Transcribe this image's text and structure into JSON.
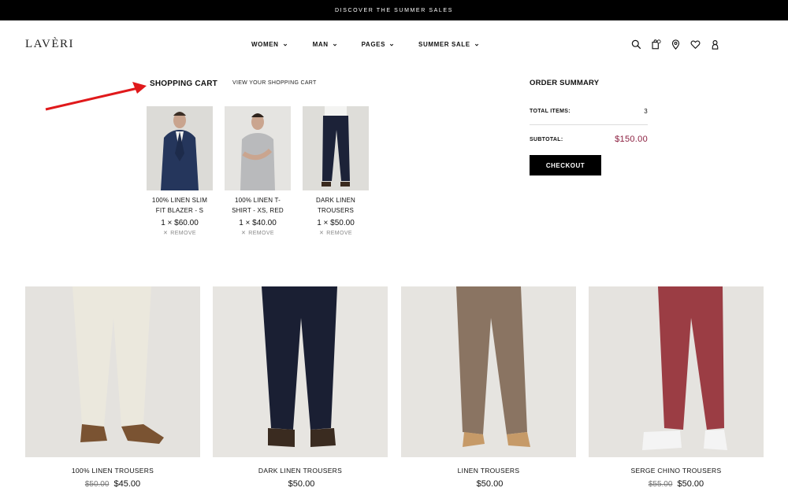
{
  "promo": {
    "text": "DISCOVER THE SUMMER SALES"
  },
  "header": {
    "logo": "LAVÈRI",
    "nav": [
      {
        "label": "WOMEN"
      },
      {
        "label": "MAN"
      },
      {
        "label": "PAGES"
      },
      {
        "label": "SUMMER SALE"
      }
    ],
    "icons": [
      "search-icon",
      "cart-icon",
      "location-icon",
      "heart-icon",
      "user-icon"
    ]
  },
  "cart": {
    "title": "SHOPPING CART",
    "view_link": "VIEW YOUR SHOPPING CART",
    "items": [
      {
        "name": "100% LINEN SLIM FIT BLAZER - S",
        "qty_price": "1 × $60.00",
        "remove": "REMOVE"
      },
      {
        "name": "100% LINEN T-SHIRT - XS, RED",
        "qty_price": "1 × $40.00",
        "remove": "REMOVE"
      },
      {
        "name": "DARK LINEN TROUSERS",
        "qty_price": "1 × $50.00",
        "remove": "REMOVE"
      }
    ]
  },
  "summary": {
    "title": "ORDER SUMMARY",
    "total_items_label": "TOTAL ITEMS:",
    "total_items_value": "3",
    "subtotal_label": "SUBTOTAL:",
    "subtotal_value": "$150.00",
    "checkout_label": "CHECKOUT"
  },
  "products": [
    {
      "name": "100% LINEN TROUSERS",
      "old_price": "$50.00",
      "price": "$45.00"
    },
    {
      "name": "DARK LINEN TROUSERS",
      "old_price": "",
      "price": "$50.00"
    },
    {
      "name": "LINEN TROUSERS",
      "old_price": "",
      "price": "$50.00"
    },
    {
      "name": "SERGE CHINO TROUSERS",
      "old_price": "$55.00",
      "price": "$50.00"
    }
  ],
  "colors": {
    "accent_price": "#8b1e3f",
    "annotation_arrow": "#e0191b",
    "promo_bg": "#000000"
  }
}
